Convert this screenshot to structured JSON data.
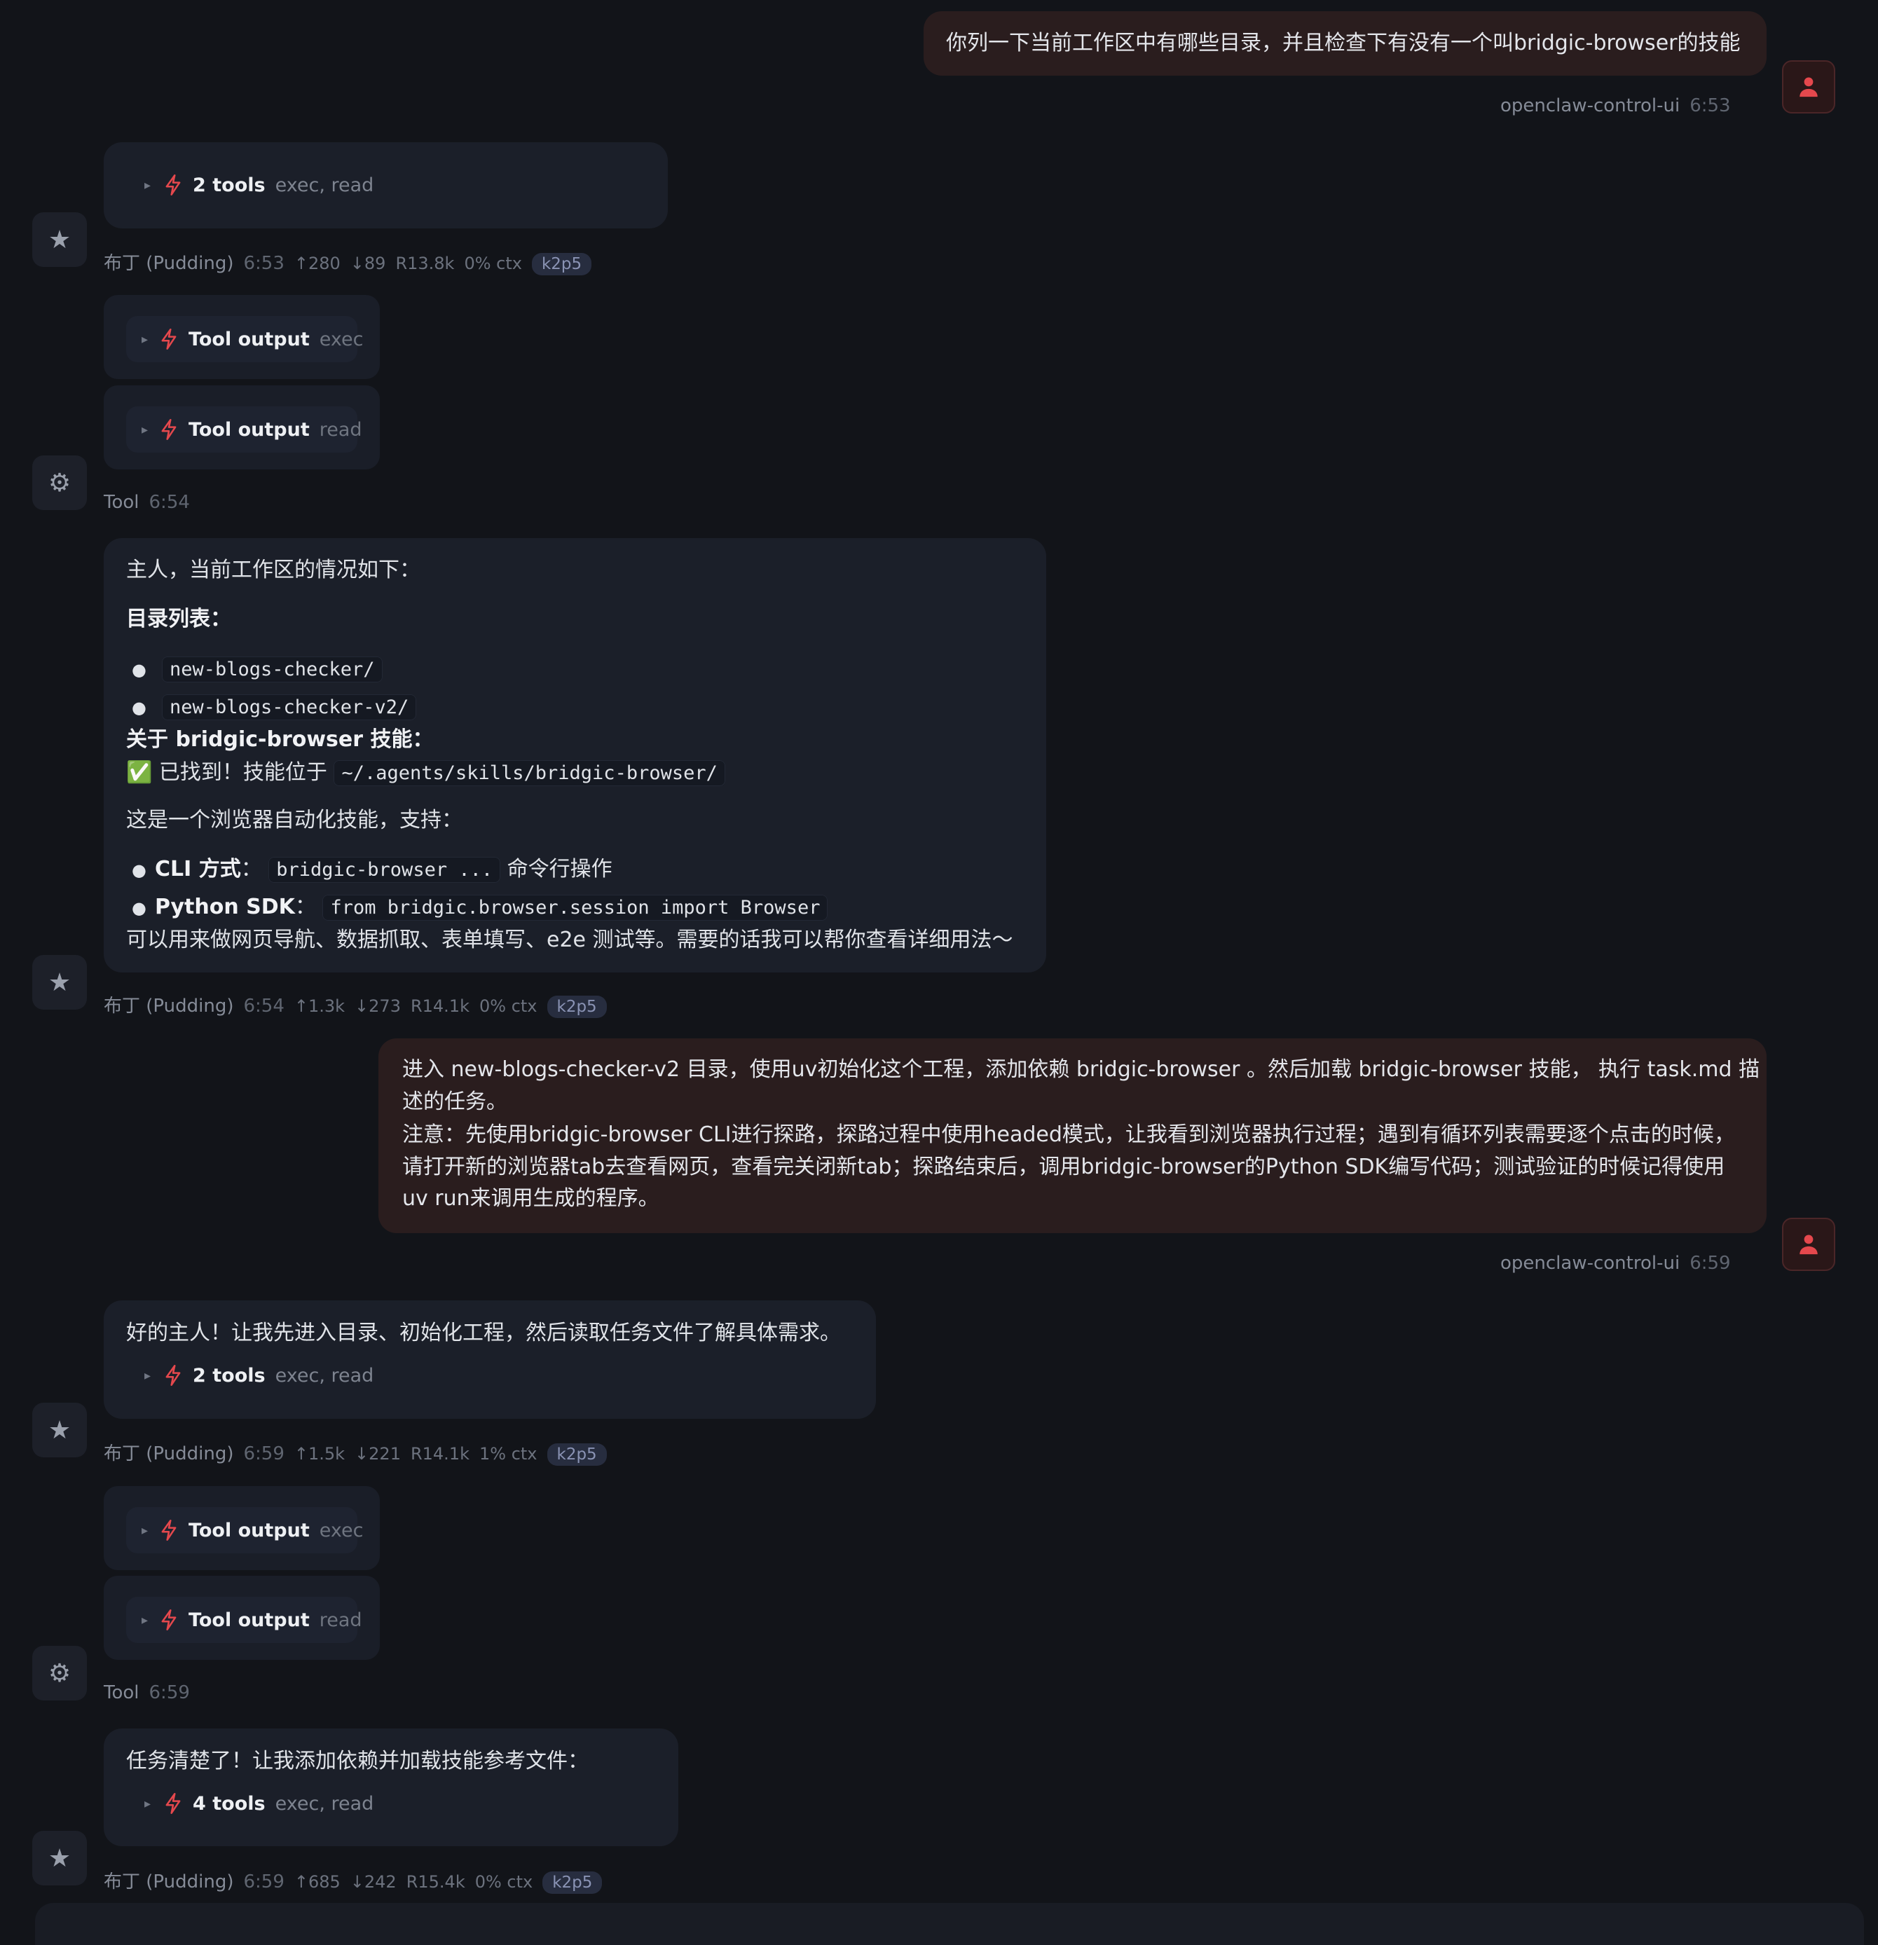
{
  "messages": {
    "m1": {
      "text": "你列一下当前工作区中有哪些目录，并且检查下有没有一个叫bridgic-browser的技能",
      "sender": "openclaw-control-ui",
      "time": "6:53"
    },
    "m2": {
      "tools_count": "2 tools",
      "tools_names": "exec, read",
      "sender": "布丁 (Pudding)",
      "time": "6:53",
      "up": "↑280",
      "down": "↓89",
      "r": "R13.8k",
      "ctx": "0% ctx",
      "model": "k2p5"
    },
    "m3": {
      "out1_label": "Tool output",
      "out1_sub": "exec",
      "out2_label": "Tool output",
      "out2_sub": "read",
      "sender": "Tool",
      "time": "6:54"
    },
    "m4": {
      "intro": "主人，当前工作区的情况如下：",
      "dir_heading": "目录列表：",
      "dirs": [
        "new-blogs-checker/",
        "new-blogs-checker-v2/"
      ],
      "skill_heading": "关于 bridgic-browser 技能：",
      "found_prefix": "✅ 已找到！技能位于",
      "found_path": "~/.agents/skills/bridgic-browser/",
      "support_line": "这是一个浏览器自动化技能，支持：",
      "cli_label": "CLI 方式",
      "cli_sep": "：",
      "cli_code": "bridgic-browser ...",
      "cli_desc": "命令行操作",
      "sdk_label": "Python SDK",
      "sdk_sep": "：",
      "sdk_code": "from bridgic.browser.session import Browser",
      "closing": "可以用来做网页导航、数据抓取、表单填写、e2e 测试等。需要的话我可以帮你查看详细用法～",
      "sender": "布丁 (Pudding)",
      "time": "6:54",
      "up": "↑1.3k",
      "down": "↓273",
      "r": "R14.1k",
      "ctx": "0% ctx",
      "model": "k2p5"
    },
    "m5": {
      "l1": "进入 new-blogs-checker-v2 目录，使用uv初始化这个工程，添加依赖 bridgic-browser 。然后加载 bridgic-browser 技能， 执行 task.md 描",
      "l2": "述的任务。",
      "l3": "注意：先使用bridgic-browser CLI进行探路，探路过程中使用headed模式，让我看到浏览器执行过程；遇到有循环列表需要逐个点击的时候，",
      "l4": "请打开新的浏览器tab去查看网页，查看完关闭新tab；探路结束后，调用bridgic-browser的Python SDK编写代码；测试验证的时候记得使用",
      "l5": "uv run来调用生成的程序。",
      "sender": "openclaw-control-ui",
      "time": "6:59"
    },
    "m6": {
      "text": "好的主人！让我先进入目录、初始化工程，然后读取任务文件了解具体需求。",
      "tools_count": "2 tools",
      "tools_names": "exec, read",
      "sender": "布丁 (Pudding)",
      "time": "6:59",
      "up": "↑1.5k",
      "down": "↓221",
      "r": "R14.1k",
      "ctx": "1% ctx",
      "model": "k2p5"
    },
    "m7": {
      "out1_label": "Tool output",
      "out1_sub": "exec",
      "out2_label": "Tool output",
      "out2_sub": "read",
      "sender": "Tool",
      "time": "6:59"
    },
    "m8": {
      "text": "任务清楚了！让我添加依赖并加载技能参考文件：",
      "tools_count": "4 tools",
      "tools_names": "exec, read",
      "sender": "布丁 (Pudding)",
      "time": "6:59",
      "up": "↑685",
      "down": "↓242",
      "r": "R15.4k",
      "ctx": "0% ctx",
      "model": "k2p5"
    }
  },
  "colors": {
    "accent": "#e5484d",
    "user_bubble": "#2a1d1e",
    "ai_bubble": "#1b1f29",
    "background": "#121419"
  }
}
